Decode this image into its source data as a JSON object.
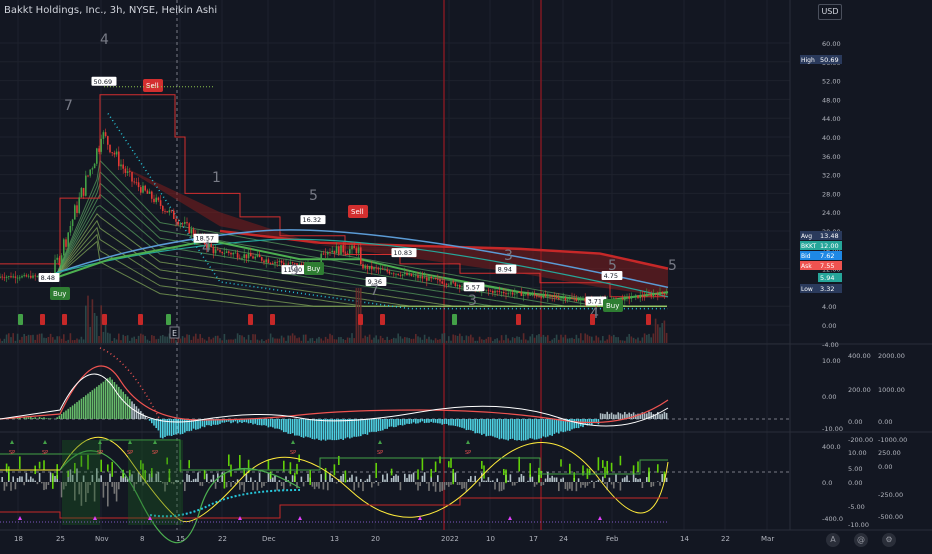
{
  "legend": {
    "title": "Bakkt Holdings, Inc., 3h, NYSE, Heikin Ashi",
    "currency": "USD"
  },
  "colors": {
    "background": "#131722",
    "grid": "#1e222d",
    "bull": "#26a69a",
    "bear": "#ef5350",
    "green_line": "#4caf50",
    "red_band": "#b71c1c",
    "blue_line": "#5b9bd5",
    "cyan_dots": "#26c6da",
    "sell_label": "#d32f2f",
    "buy_label": "#2e7d32"
  },
  "price_axis": {
    "ticks": [
      "60.00",
      "56.00",
      "52.00",
      "48.00",
      "44.00",
      "40.00",
      "36.00",
      "32.00",
      "28.00",
      "24.00",
      "20.00",
      "16.00",
      "12.00",
      "8.00",
      "4.00",
      "0.00",
      "-4.00"
    ]
  },
  "price_tags": [
    {
      "label": "High",
      "value": "50.69",
      "color": "#2a3a5c"
    },
    {
      "label": "Avg",
      "value": "13.48",
      "color": "#2a3a5c"
    },
    {
      "label": "BKKT",
      "value": "12.00",
      "color": "#26a69a"
    },
    {
      "label": "Bid",
      "value": "7.62",
      "color": "#1e88e5"
    },
    {
      "label": "Ask",
      "value": "7.55",
      "color": "#ef5350"
    },
    {
      "label": "",
      "value": "5.94",
      "color": "#26a69a"
    },
    {
      "label": "Low",
      "value": "3.32",
      "color": "#2a3a5c"
    }
  ],
  "annotations": {
    "price_labels": [
      "50.69",
      "18.57",
      "11.90",
      "16.32",
      "8.48",
      "9.36",
      "10.83",
      "8.94",
      "5.57",
      "4.75",
      "3.71"
    ],
    "count_numbers": [
      "4",
      "7",
      "1",
      "4",
      "5",
      "9",
      "7",
      "3",
      "3",
      "5",
      "4",
      "5"
    ],
    "signals": [
      {
        "type": "sell",
        "label": "Sell"
      },
      {
        "type": "sell",
        "label": "Sell"
      },
      {
        "type": "buy",
        "label": "Buy"
      },
      {
        "type": "buy",
        "label": "Buy"
      },
      {
        "type": "buy",
        "label": "Buy"
      }
    ],
    "marker_letter": "E"
  },
  "indicator1": {
    "left_ticks": [
      "10.00",
      "0.00",
      "-10.00"
    ],
    "mid_ticks": [
      "400.00",
      "200.00",
      "0.00",
      "-200.00"
    ],
    "right_ticks": [
      "2000.00",
      "1000.00",
      "0.00",
      "-1000.00"
    ]
  },
  "indicator2": {
    "left_ticks": [
      "400.0",
      "0.0",
      "-400.0"
    ],
    "mid_ticks": [
      "10.00",
      "5.00",
      "0.00",
      "-5.00",
      "-10.00"
    ],
    "right_ticks": [
      "250.00",
      "0.00",
      "-250.00",
      "-500.00"
    ],
    "mark_label": "SP"
  },
  "time_axis": {
    "labels": [
      "18",
      "25",
      "Nov",
      "8",
      "15",
      "22",
      "Dec",
      "13",
      "20",
      "2022",
      "10",
      "17",
      "24",
      "Feb",
      "14",
      "22",
      "Mar"
    ]
  },
  "bottom_buttons": [
    "A",
    "@",
    "⚙"
  ]
}
